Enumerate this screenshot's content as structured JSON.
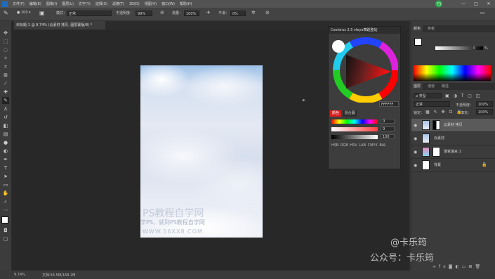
{
  "menu": [
    "文件(F)",
    "编辑(E)",
    "图像(I)",
    "图层(L)",
    "文字(Y)",
    "选择(S)",
    "滤镜(T)",
    "3D(D)",
    "视图(V)",
    "窗口(W)",
    "帮助(H)"
  ],
  "avatar_text": "73",
  "window_controls": [
    "—",
    "□",
    "✕"
  ],
  "options": {
    "brush_size": "200",
    "mode_label": "模式：",
    "mode_value": "正常",
    "opacity_label": "不透明度：",
    "opacity_value": "99%",
    "flow_label": "流量：",
    "flow_value": "100%",
    "smooth_label": "平滑：",
    "smooth_value": "0%"
  },
  "document_tab": "未标题-1 @ 9.74% (云素材 拷贝, 图层蒙版/8) *",
  "watermark": {
    "line1": "PS教程自学网",
    "line2": "学PS，就到PS教程自学网",
    "line3": "WWW.16XX8.COM"
  },
  "picker": {
    "title": "Coolorus 2.5 vleyo舞蹈整站",
    "hex": "FFFFFF",
    "tab_active": "颜色",
    "tab_other": "混合器",
    "value1": "0",
    "value2": "0",
    "value3": "100",
    "modes": "HSB  RGB  HSV  LAB  CMYK  BAL"
  },
  "panels": {
    "color_tabs": [
      "颜色",
      "色板"
    ],
    "color_value": "0",
    "color_pct": "%",
    "layer_tabs": [
      "图层",
      "通道",
      "路径"
    ],
    "filter_label": "ρ 类型",
    "blend_mode": "正常",
    "opacity_label": "不透明度：",
    "opacity_value": "100%",
    "lock_label": "锁定：",
    "fill_label": "填充：",
    "fill_value": "100%",
    "layers": [
      {
        "name": "云素材 拷贝",
        "selected": true,
        "visible": true
      },
      {
        "name": "云素材",
        "selected": false,
        "visible": true
      },
      {
        "name": "渐变填充 1",
        "selected": false,
        "visible": true
      },
      {
        "name": "背景",
        "selected": false,
        "visible": true
      }
    ]
  },
  "status": {
    "zoom": "9.74%",
    "doc": "文档:56.5M/168.2M"
  },
  "credits": {
    "line1": "@卡乐筠",
    "line2": "公众号：卡乐筠"
  },
  "colors": {
    "accent_red": "#d92020",
    "panel_bg": "#3b3b3b",
    "menu_bg": "#535353"
  }
}
